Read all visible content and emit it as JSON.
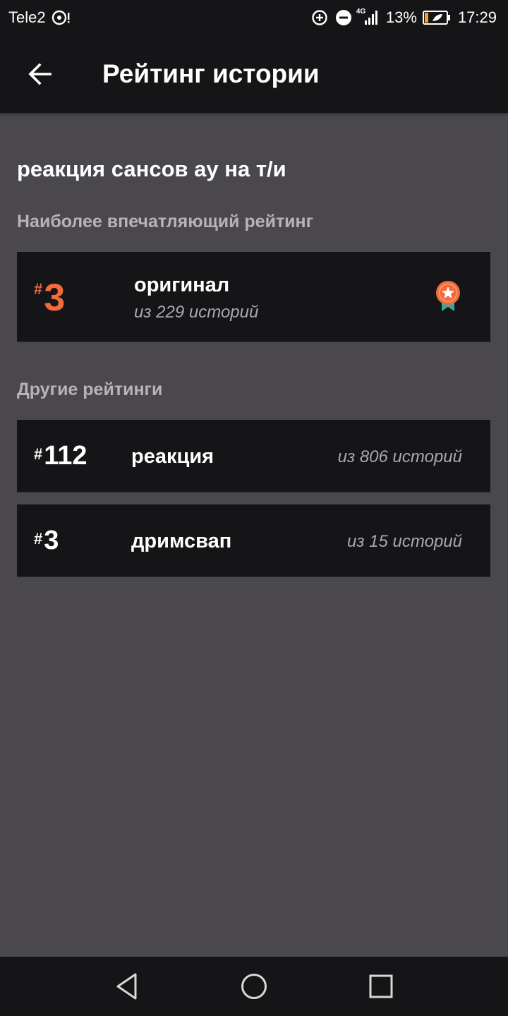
{
  "status_bar": {
    "carrier": "Tele2",
    "network": "4G",
    "battery": "13%",
    "time": "17:29"
  },
  "header": {
    "title": "Рейтинг истории"
  },
  "story": {
    "title": "реакция сансов ау на т/и"
  },
  "best": {
    "heading": "Наиболее впечатляющий рейтинг",
    "hash": "#",
    "rank": "3",
    "category": "оригинал",
    "out_of": "из 229 историй",
    "badge_icon": "medal-star-icon"
  },
  "others": {
    "heading": "Другие рейтинги",
    "items": [
      {
        "hash": "#",
        "rank": "112",
        "category": "реакция",
        "out_of": "из 806 историй"
      },
      {
        "hash": "#",
        "rank": "3",
        "category": "дримсвап",
        "out_of": "из 15 историй"
      }
    ]
  },
  "colors": {
    "accent": "#f26b3a",
    "background": "#4a484c",
    "card": "#151417",
    "muted_text": "#a9a7ad",
    "badge_ribbon": "#3fa3a0"
  }
}
